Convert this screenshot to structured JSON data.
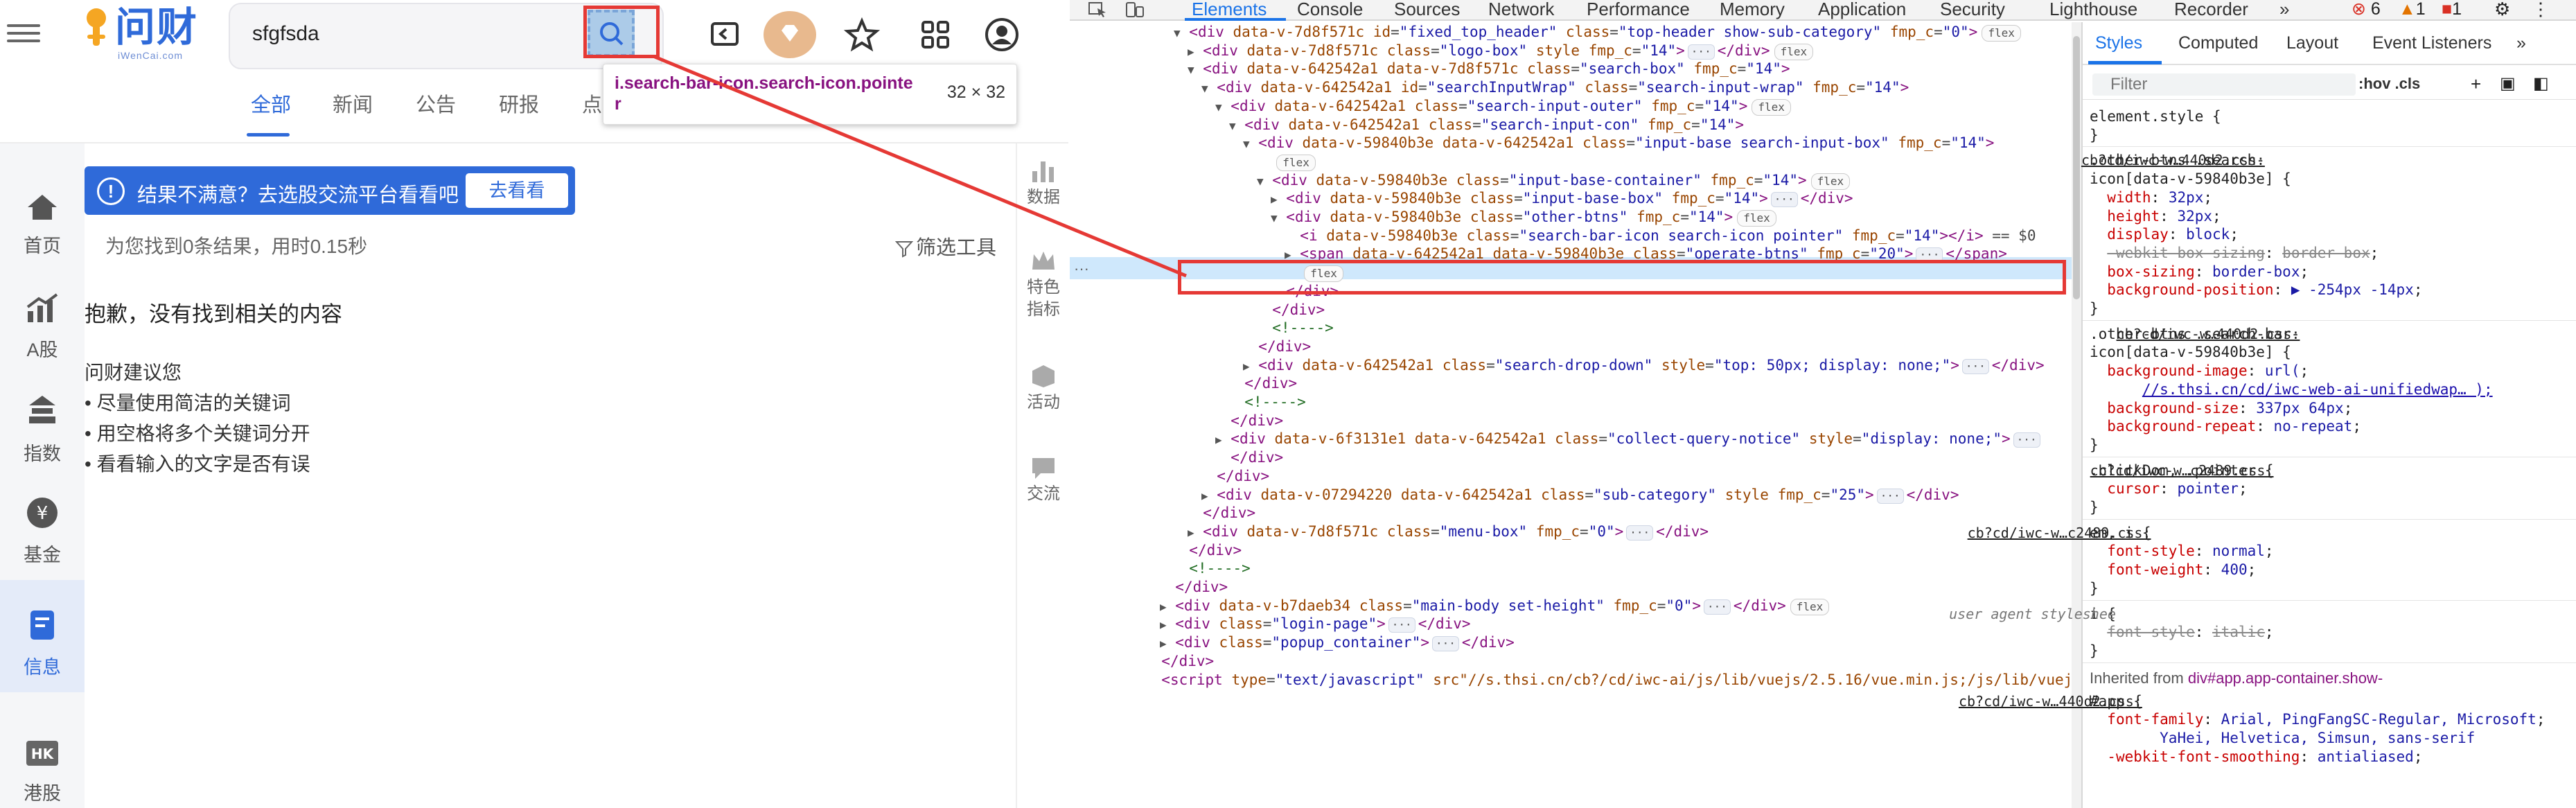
{
  "webpage": {
    "logo": {
      "title": "问财",
      "subtitle": "iWenCai.com"
    },
    "search": {
      "value": "sfgfsda"
    },
    "tooltip": {
      "selector": "i.search-bar-icon.search-icon.pointer",
      "dimensions": "32 × 32"
    },
    "toolbar_icons": [
      "history-icon",
      "vip-gem-icon",
      "star-icon",
      "apps-grid-icon",
      "user-icon"
    ],
    "tabs": [
      {
        "label": "全部",
        "active": true
      },
      {
        "label": "新闻",
        "active": false
      },
      {
        "label": "公告",
        "active": false
      },
      {
        "label": "研报",
        "active": false
      },
      {
        "label": "点",
        "active": false
      }
    ],
    "leftnav": [
      {
        "label": "首页",
        "icon": "home-icon",
        "active": false
      },
      {
        "label": "A股",
        "icon": "chart-icon",
        "active": false
      },
      {
        "label": "指数",
        "icon": "index-icon",
        "active": false
      },
      {
        "label": "基金",
        "icon": "yen-icon",
        "active": false
      },
      {
        "label": "信息",
        "icon": "doc-icon",
        "active": true
      },
      {
        "label": "港股",
        "icon": "hk-icon",
        "active": false
      }
    ],
    "sidestrip": [
      {
        "label": "数据",
        "icon": "bar-chart-icon"
      },
      {
        "label": "特色\n指标",
        "icon": "crown-icon"
      },
      {
        "label": "活动",
        "icon": "cube-icon"
      },
      {
        "label": "交流",
        "icon": "chat-icon"
      }
    ],
    "banner": {
      "text": "结果不满意？去选股交流平台看看吧",
      "button": "去看看"
    },
    "stats": "为您找到0条结果，用时0.15秒",
    "filter": "筛选工具",
    "noresult": "抱歉，没有找到相关的内容",
    "suggest_title": "问财建议您",
    "suggestions": [
      "• 尽量使用简洁的关键词",
      "• 用空格将多个关键词分开",
      "• 看看输入的文字是否有误"
    ]
  },
  "devtools": {
    "tabs": [
      "Elements",
      "Console",
      "Sources",
      "Network",
      "Performance",
      "Memory",
      "Application",
      "Security",
      "Lighthouse",
      "Recorder"
    ],
    "active_tab": "Elements",
    "badges": {
      "errors": "6",
      "warnings": "1",
      "issues": "1"
    },
    "tree": [
      {
        "indent": 0,
        "arrow": "▼",
        "html": "<div data-v-7d8f571c id=\"fixed_top_header\" class=\"top-header show-sub-category\" fmp_c=\"0\">",
        "flex": true
      },
      {
        "indent": 1,
        "arrow": "▶",
        "html": "<div data-v-7d8f571c class=\"logo-box\" style fmp_c=\"14\">",
        "ell": true,
        "close": "</div>",
        "flex": true
      },
      {
        "indent": 1,
        "arrow": "▼",
        "html": "<div data-v-642542a1 data-v-7d8f571c class=\"search-box\" fmp_c=\"14\">"
      },
      {
        "indent": 2,
        "arrow": "▼",
        "html": "<div data-v-642542a1 id=\"searchInputWrap\" class=\"search-input-wrap\" fmp_c=\"14\">"
      },
      {
        "indent": 3,
        "arrow": "▼",
        "html": "<div data-v-642542a1 class=\"search-input-outer\" fmp_c=\"14\">",
        "flex": true
      },
      {
        "indent": 4,
        "arrow": "▼",
        "html": "<div data-v-642542a1 class=\"search-input-con\" fmp_c=\"14\">"
      },
      {
        "indent": 5,
        "arrow": "▼",
        "html": "<div data-v-59840b3e data-v-642542a1 class=\"input-base search-input-box\" fmp_c=\"14\">"
      },
      {
        "indent": 6,
        "arrow": "",
        "html": "",
        "flex": true
      },
      {
        "indent": 6,
        "arrow": "▼",
        "html": "<div data-v-59840b3e class=\"input-base-container\" fmp_c=\"14\">",
        "flex": true
      },
      {
        "indent": 7,
        "arrow": "▶",
        "html": "<div data-v-59840b3e class=\"input-base-box\" fmp_c=\"14\">",
        "ell": true,
        "close": "</div>"
      },
      {
        "indent": 7,
        "arrow": "▼",
        "html": "<div data-v-59840b3e class=\"other-btns\" fmp_c=\"14\">",
        "flex": true
      },
      {
        "indent": 8,
        "arrow": "",
        "html": "<i data-v-59840b3e class=\"search-bar-icon search-icon pointer\" fmp_c=\"14\"></i> == $0",
        "selected": true
      },
      {
        "indent": 8,
        "arrow": "▶",
        "html": "<span data-v-642542a1 data-v-59840b3e class=\"operate-btns\" fmp_c=\"20\">",
        "ell": true,
        "close": "</span>"
      },
      {
        "indent": 8,
        "arrow": "",
        "html": "",
        "flex": true
      },
      {
        "indent": 7,
        "arrow": "",
        "html": "</div>"
      },
      {
        "indent": 6,
        "arrow": "",
        "html": "</div>"
      },
      {
        "indent": 6,
        "arrow": "",
        "html": "<!---->",
        "comment": true
      },
      {
        "indent": 5,
        "arrow": "",
        "html": "</div>"
      },
      {
        "indent": 5,
        "arrow": "▶",
        "html": "<div data-v-642542a1 class=\"search-drop-down\" style=\"top: 50px; display: none;\">",
        "ell": true,
        "close": "</div>"
      },
      {
        "indent": 4,
        "arrow": "",
        "html": "</div>"
      },
      {
        "indent": 4,
        "arrow": "",
        "html": "<!---->",
        "comment": true
      },
      {
        "indent": 3,
        "arrow": "",
        "html": "</div>"
      },
      {
        "indent": 3,
        "arrow": "▶",
        "html": "<div data-v-6f3131e1 data-v-642542a1 class=\"collect-query-notice\" style=\"display: none;\">",
        "ell": true
      },
      {
        "indent": 3,
        "arrow": "",
        "html": "</div>"
      },
      {
        "indent": 2,
        "arrow": "",
        "html": "</div>"
      },
      {
        "indent": 2,
        "arrow": "▶",
        "html": "<div data-v-07294220 data-v-642542a1 class=\"sub-category\" style fmp_c=\"25\">",
        "ell": true,
        "close": "</div>"
      },
      {
        "indent": 1,
        "arrow": "",
        "html": "</div>"
      },
      {
        "indent": 1,
        "arrow": "▶",
        "html": "<div data-v-7d8f571c class=\"menu-box\" fmp_c=\"0\">",
        "ell": true,
        "close": "</div>"
      },
      {
        "indent": 0,
        "arrow": "",
        "html": "</div>"
      },
      {
        "indent": 0,
        "arrow": "",
        "html": "<!---->",
        "comment": true
      },
      {
        "indent": -1,
        "arrow": "",
        "html": "</div>"
      },
      {
        "indent": -1,
        "arrow": "▶",
        "html": "<div data-v-b7daeb34 class=\"main-body set-height\" fmp_c=\"0\">",
        "ell": true,
        "close": "</div>",
        "flex": true
      },
      {
        "indent": -1,
        "arrow": "▶",
        "html": "<div class=\"login-page\">",
        "ell": true,
        "close": "</div>"
      },
      {
        "indent": -1,
        "arrow": "▶",
        "html": "<div class=\"popup_container\">",
        "ell": true,
        "close": "</div>"
      },
      {
        "indent": -2,
        "arrow": "",
        "html": "</div>"
      },
      {
        "indent": -2,
        "arrow": "",
        "html": "<script type=\"text/javascript\" src=\"//s.thsi.cn/cb?/cd/iwc-ai/js/lib/vuejs/2.5.16/vue.min.js;/js/lib/vuejs/..."
      }
    ],
    "styles": {
      "tabs": [
        "Styles",
        "Computed",
        "Layout",
        "Event Listeners"
      ],
      "filter_placeholder": "Filter",
      "hov": ":hov  .cls",
      "rules": [
        {
          "selector": "element.style {",
          "props": [],
          "close": "}"
        },
        {
          "selector": ".other-btns .search-",
          "selector2": "icon[data-v-59840b3e] {",
          "src": "cb?cd/iwc-w…440d2.css:",
          "props": [
            [
              "width",
              "32px"
            ],
            [
              "height",
              "32px"
            ],
            [
              "display",
              "block"
            ],
            [
              "-webkit-box-sizing",
              "border-box",
              true
            ],
            [
              "box-sizing",
              "border-box"
            ],
            [
              "background-position",
              "▶ -254px -14px"
            ]
          ]
        },
        {
          "selector": ".other-btns .search-bar-",
          "selector2": "icon[data-v-59840b3e] {",
          "src": "cb?cd/iwc-w…440d2.css:",
          "props": [
            [
              "background-image",
              "url("
            ],
            [
              "",
              "//s.thsi.cn/cd/iwc-web-ai-unifiedwap…  );"
            ],
            [
              "background-size",
              "337px 64px"
            ],
            [
              "background-repeat",
              "no-repeat"
            ]
          ]
        },
        {
          "selector": ".clickDom, .pointer {",
          "src": "cb?cd/iwc-w…c2489.css:",
          "props": [
            [
              "cursor",
              "pointer"
            ]
          ]
        },
        {
          "selector": "em, i {",
          "src": "cb?cd/iwc-w…c2489.css:",
          "props": [
            [
              "font-style",
              "normal"
            ],
            [
              "font-weight",
              "400"
            ]
          ]
        },
        {
          "selector": "i {",
          "ua": "user agent styleshee",
          "props": [
            [
              "font-style",
              "italic",
              true
            ]
          ]
        }
      ],
      "inherited_label": "Inherited from ",
      "inherited_from": "div#app.app-container.show-",
      "app_rule": {
        "selector": "#app {",
        "src": "cb?cd/iwc-w…440d2.css:",
        "props": [
          [
            "font-family",
            "Arial, PingFangSC-Regular, Microsoft"
          ],
          [
            "",
            "YaHei, Helvetica, Simsun, sans-serif"
          ],
          [
            "-webkit-font-smoothing",
            "antialiased"
          ]
        ]
      }
    }
  },
  "colors": {
    "accent": "#2f6ad9",
    "highlight_red": "#e53935",
    "devtools_blue": "#1a73e8"
  }
}
